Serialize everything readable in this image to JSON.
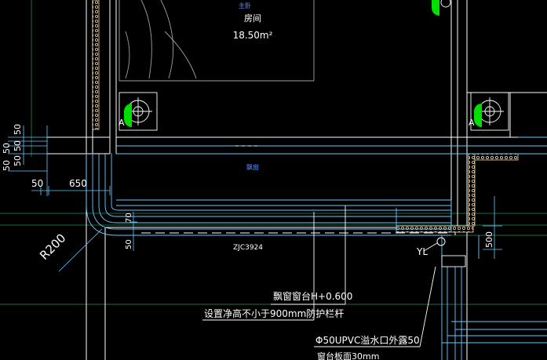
{
  "room": {
    "tag": "主卧",
    "name": "房间",
    "area": "18.50m²"
  },
  "bay_window_label": "飘窗",
  "callouts": {
    "sill_height": "飘窗窗台H+0.600",
    "railing": "设置净高不小于900mm防护栏杆",
    "overflow_pipe": "Φ50UPVC溢水口外露50",
    "bottom_partial": "窗台板面30mm"
  },
  "dimensions": {
    "left_stack": [
      "50",
      "50",
      "50"
    ],
    "left_stack_side": [
      "50",
      "50"
    ],
    "offset_50": "50",
    "offset_650": "650",
    "radius": "R200",
    "small_70": "70",
    "small_50": "50",
    "right_500": "500"
  },
  "detail_ref": "ZJC3924",
  "pipe_tag": "YL",
  "marker_letter": "A",
  "colors": {
    "background": "#000000",
    "wall_line": "#ffffff",
    "window_line": "#66c8ff",
    "insulation": "#f5d9a8",
    "marker_green": "#00e000",
    "grid_green": "#1f8f4f",
    "dim_line": "#66c8ff"
  }
}
